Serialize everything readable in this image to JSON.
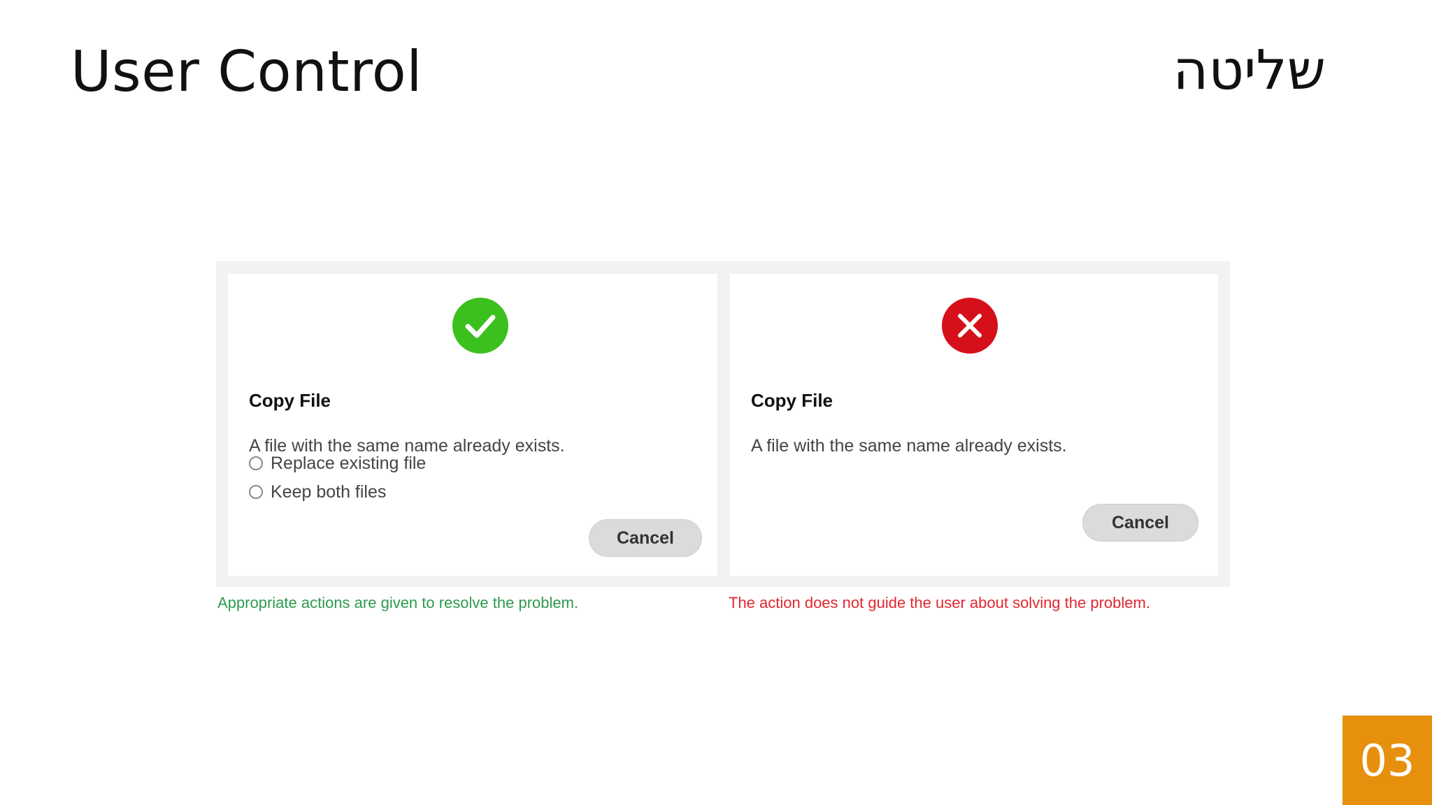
{
  "slide": {
    "title": "User Control",
    "title_hebrew": "שליטה",
    "page_number": "03"
  },
  "colors": {
    "good_icon": "#3cc01e",
    "bad_icon": "#d6101a",
    "good_caption": "#2e9a4e",
    "bad_caption": "#e0282f",
    "page_badge": "#e6900d"
  },
  "good_example": {
    "icon": "checkmark-icon",
    "dialog_title": "Copy File",
    "message": "A file with the same name already exists.",
    "options": [
      "Replace existing file",
      "Keep both files"
    ],
    "cancel_label": "Cancel",
    "caption": "Appropriate actions are given to resolve the problem."
  },
  "bad_example": {
    "icon": "cross-icon",
    "dialog_title": "Copy File",
    "message": "A file with the same name already exists.",
    "cancel_label": "Cancel",
    "caption": "The action does not guide the user about solving the problem."
  }
}
